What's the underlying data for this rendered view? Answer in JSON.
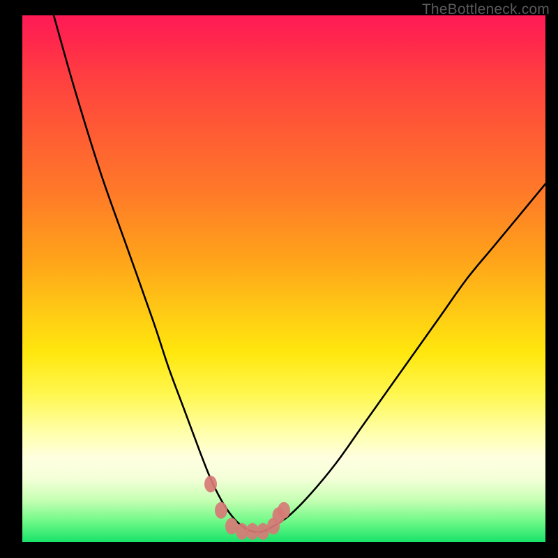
{
  "watermark": "TheBottleneck.com",
  "colors": {
    "background": "#000000",
    "curve": "#000000",
    "markers": "#d77a76",
    "gradient_stops": [
      "#ff1a56",
      "#ff4040",
      "#ff7b28",
      "#ffc915",
      "#ffffa8",
      "#71f988",
      "#19e36a"
    ]
  },
  "chart_data": {
    "type": "line",
    "title": "",
    "xlabel": "",
    "ylabel": "",
    "xlim": [
      0,
      100
    ],
    "ylim": [
      0,
      100
    ],
    "grid": false,
    "legend": false,
    "series": [
      {
        "name": "bottleneck-curve",
        "x": [
          6,
          10,
          15,
          20,
          25,
          28,
          31,
          34,
          36,
          38,
          40,
          42,
          44,
          46,
          48,
          51,
          55,
          60,
          65,
          70,
          75,
          80,
          85,
          90,
          95,
          100
        ],
        "values": [
          100,
          86,
          70,
          56,
          42,
          33,
          25,
          17,
          12,
          8,
          5,
          3,
          2,
          2,
          3,
          5,
          9,
          15,
          22,
          29,
          36,
          43,
          50,
          56,
          62,
          68
        ]
      }
    ],
    "markers": {
      "name": "highlighted-points",
      "x": [
        36,
        38,
        40,
        42,
        44,
        46,
        48,
        49,
        50
      ],
      "values": [
        11,
        6,
        3,
        2,
        2,
        2,
        3,
        5,
        6
      ]
    },
    "annotations": []
  }
}
